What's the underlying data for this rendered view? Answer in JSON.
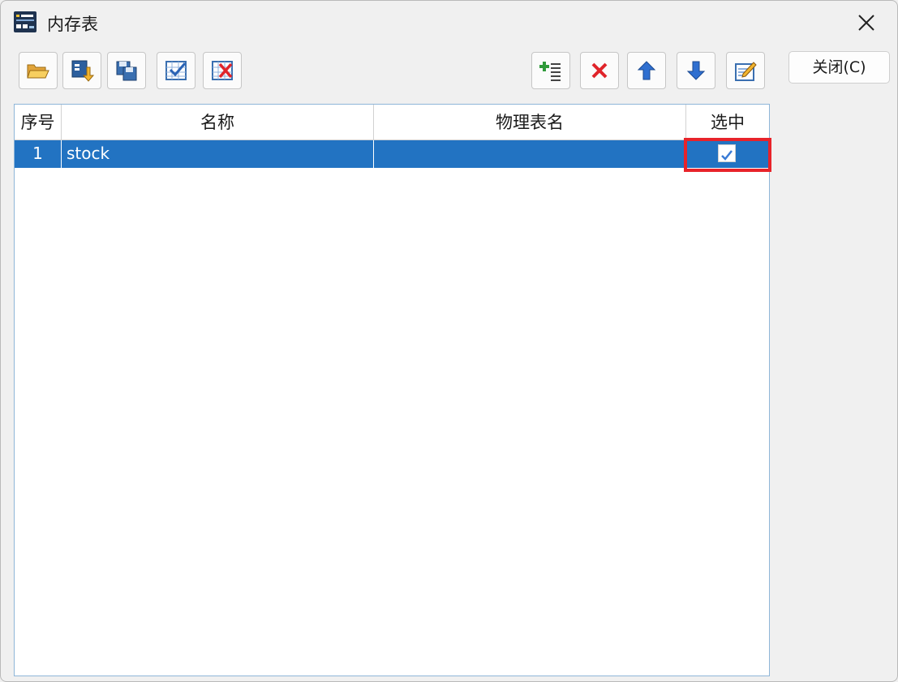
{
  "window": {
    "title": "内存表",
    "close_button_label": "关闭(C)"
  },
  "toolbar_left": [
    {
      "name": "open-icon"
    },
    {
      "name": "import-icon"
    },
    {
      "name": "save-icon"
    },
    {
      "name": "select-all-icon"
    },
    {
      "name": "deselect-all-icon"
    }
  ],
  "toolbar_right": [
    {
      "name": "add-row-icon"
    },
    {
      "name": "delete-icon"
    },
    {
      "name": "move-up-icon"
    },
    {
      "name": "move-down-icon"
    },
    {
      "name": "edit-icon"
    }
  ],
  "table": {
    "columns": [
      "序号",
      "名称",
      "物理表名",
      "选中"
    ],
    "rows": [
      {
        "index": "1",
        "name": "stock",
        "physical_name": "",
        "selected": true
      }
    ]
  },
  "colors": {
    "selection": "#2273c2",
    "highlight": "#e8232a"
  }
}
